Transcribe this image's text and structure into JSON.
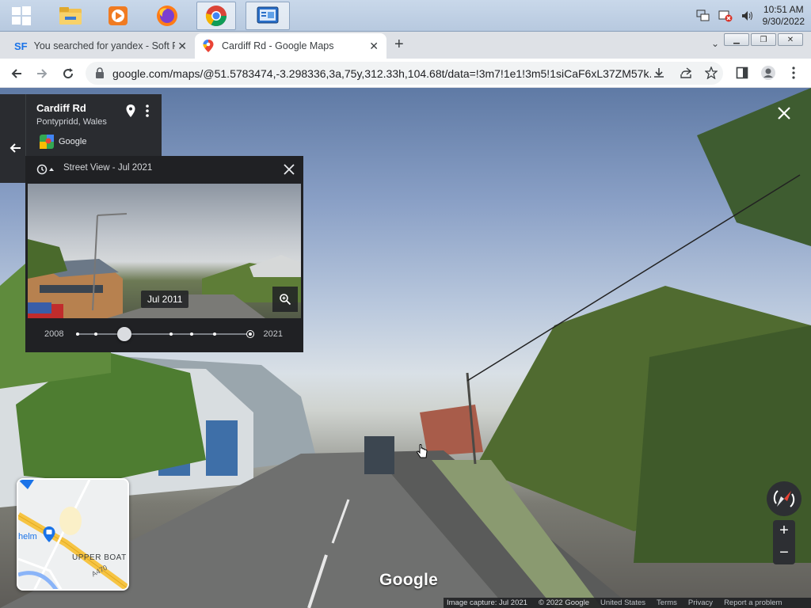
{
  "taskbar": {
    "clock_time": "10:51 AM",
    "clock_date": "9/30/2022",
    "apps": [
      "windows-start-icon",
      "file-explorer-icon",
      "media-player-icon",
      "firefox-icon",
      "chrome-icon",
      "control-panel-icon"
    ]
  },
  "tabs": [
    {
      "favicon": "SF",
      "title": "You searched for yandex - Soft Fa"
    },
    {
      "title": "Cardiff Rd - Google Maps"
    }
  ],
  "toolbar": {
    "url": "google.com/maps/@51.5783474,-3.298336,3a,75y,312.33h,104.68t/data=!3m7!1e1!3m5!1siCaF6xL37ZM57k..."
  },
  "infocard": {
    "title": "Cardiff Rd",
    "subtitle": "Pontypridd, Wales",
    "source": "Google"
  },
  "timepanel": {
    "label": "Street View - Jul 2021",
    "selected_date": "Jul 2011",
    "start_year": "2008",
    "end_year": "2021"
  },
  "minimap": {
    "place_label": "UPPER BOAT",
    "partial_label": "helm",
    "road_label": "A470"
  },
  "brand": "Google",
  "footer": {
    "capture": "Image capture: Jul 2021",
    "copyright": "© 2022 Google",
    "region": "United States",
    "terms": "Terms",
    "privacy": "Privacy",
    "report": "Report a problem"
  }
}
